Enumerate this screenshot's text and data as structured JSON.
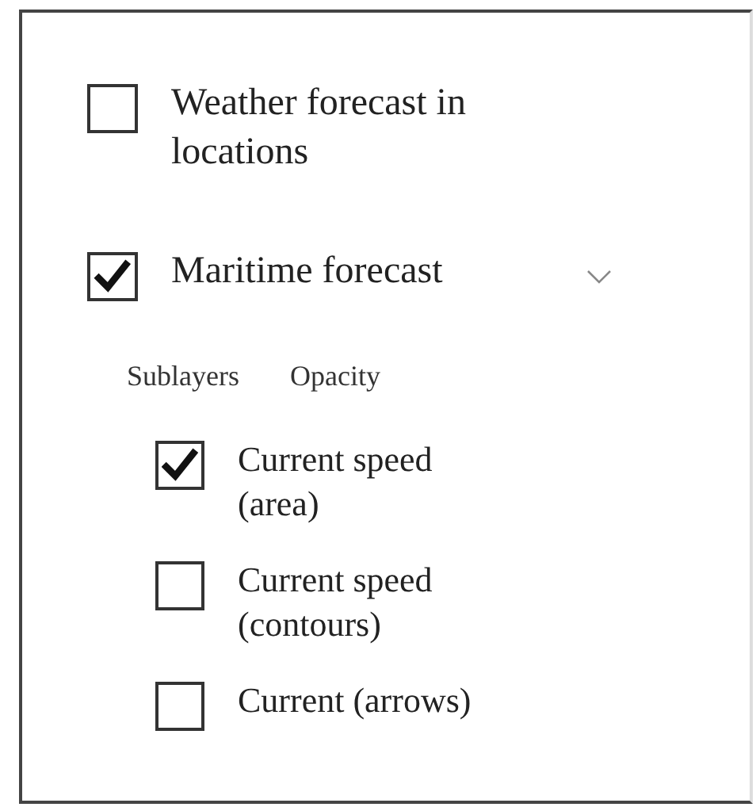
{
  "layers": [
    {
      "label": "Weather forecast in locations",
      "checked": false
    },
    {
      "label": "Maritime forecast",
      "checked": true,
      "expanded": true,
      "tabs": [
        "Sublayers",
        "Opacity"
      ],
      "sublayers": [
        {
          "label": "Current speed (area)",
          "checked": true
        },
        {
          "label": "Current speed (contours)",
          "checked": false
        },
        {
          "label": "Current (arrows)",
          "checked": false
        }
      ]
    }
  ]
}
